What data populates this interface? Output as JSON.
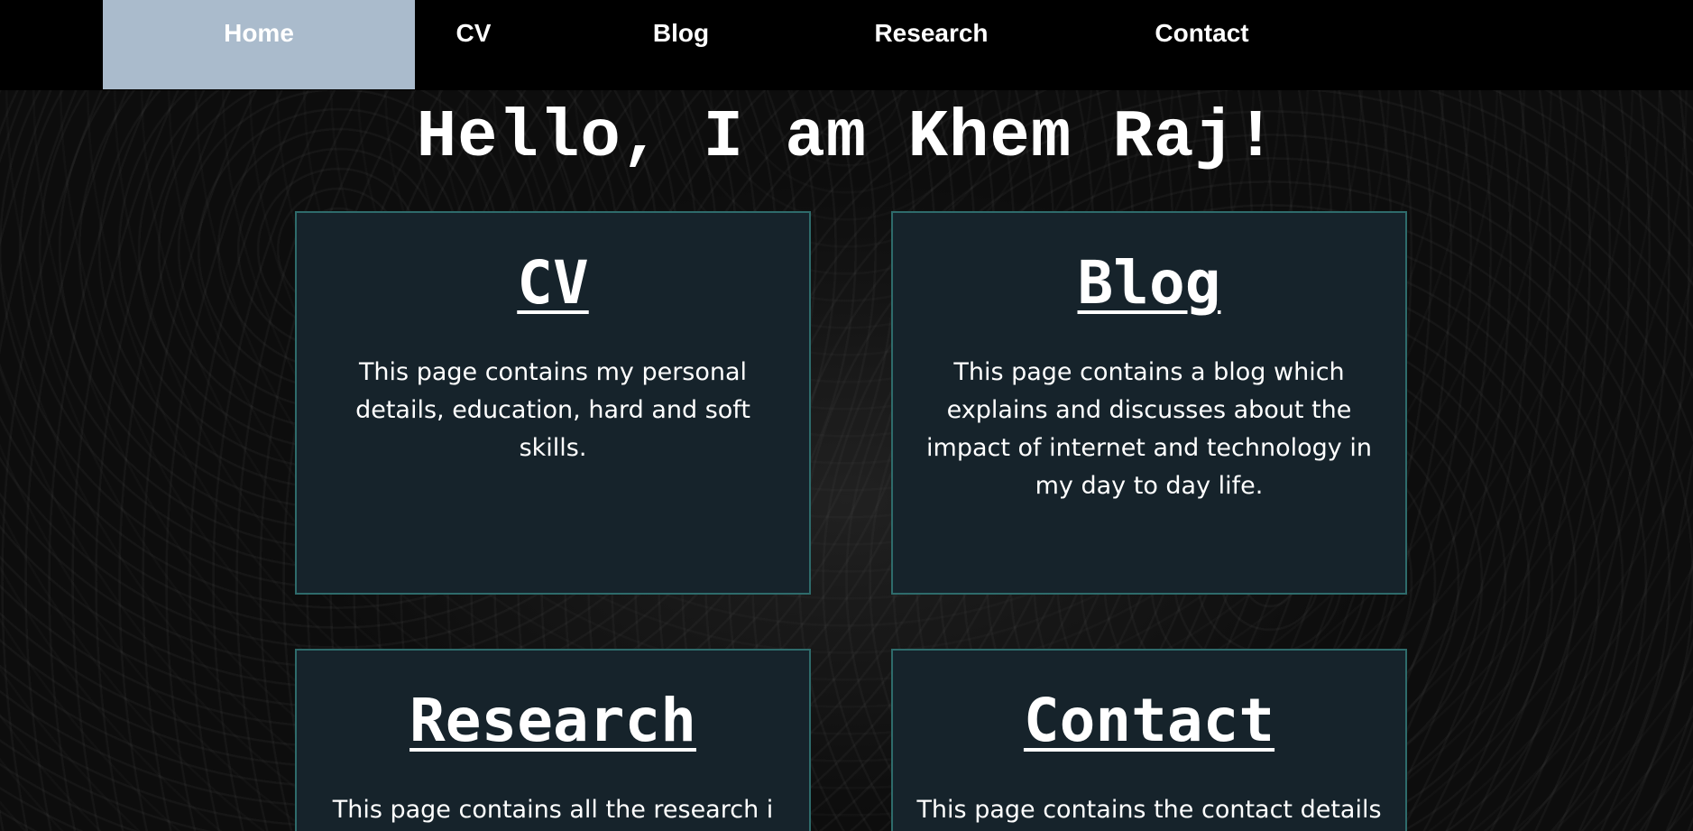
{
  "nav": {
    "items": [
      {
        "label": "Home"
      },
      {
        "label": "CV"
      },
      {
        "label": "Blog"
      },
      {
        "label": "Research"
      },
      {
        "label": "Contact"
      }
    ],
    "active_bg": "#aabbcc"
  },
  "hero": {
    "title": "Hello, I am Khem Raj!"
  },
  "cards": [
    {
      "title": "CV",
      "text": "This page contains my personal details, education, hard and soft skills."
    },
    {
      "title": "Blog",
      "text": "This page contains a blog which explains and discusses about the impact of internet and technology in my day to day life."
    },
    {
      "title": "Research",
      "text": "This page contains all the research i"
    },
    {
      "title": "Contact",
      "text": "This page contains the contact details"
    }
  ],
  "colors": {
    "card_bg": "#16232b",
    "card_border": "#2e6b6b",
    "nav_bg": "#000000"
  }
}
